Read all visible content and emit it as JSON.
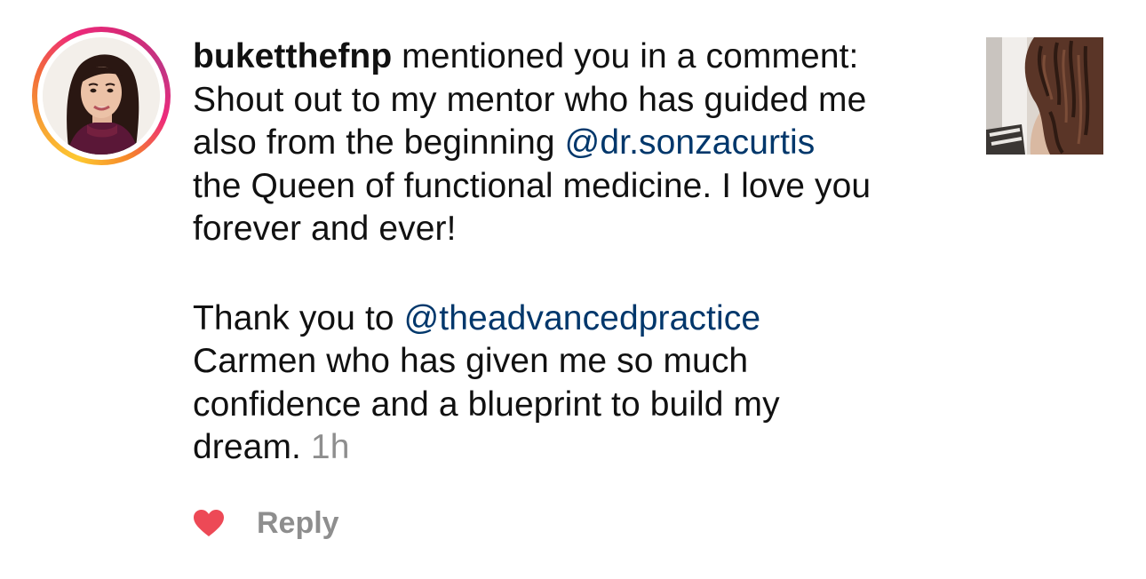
{
  "notification": {
    "username": "buketthefnp",
    "action_text": " mentioned you in a comment:",
    "avatar_icon": "profile-photo",
    "thumbnail_icon": "post-thumbnail",
    "comment": {
      "paragraph1": {
        "line1": "Shout out to my mentor who has guided me",
        "line2_prefix": "also from the beginning ",
        "mention1": "@dr.sonzacurtis",
        "line3": "the Queen of functional medicine. I love you",
        "line4": "forever and ever!"
      },
      "paragraph2": {
        "line1_prefix": "Thank you to ",
        "mention2": "@theadvancedpractice",
        "line2": "Carmen who has given me so much",
        "line3": "confidence and a blueprint to build my",
        "line4": "dream."
      }
    },
    "timestamp": "1h",
    "actions": {
      "like_icon": "heart-icon",
      "like_color": "#ed4956",
      "reply_label": "Reply"
    }
  },
  "colors": {
    "mention": "#00376b",
    "muted": "#8e8e8e",
    "text": "#111111",
    "like": "#ed4956"
  }
}
